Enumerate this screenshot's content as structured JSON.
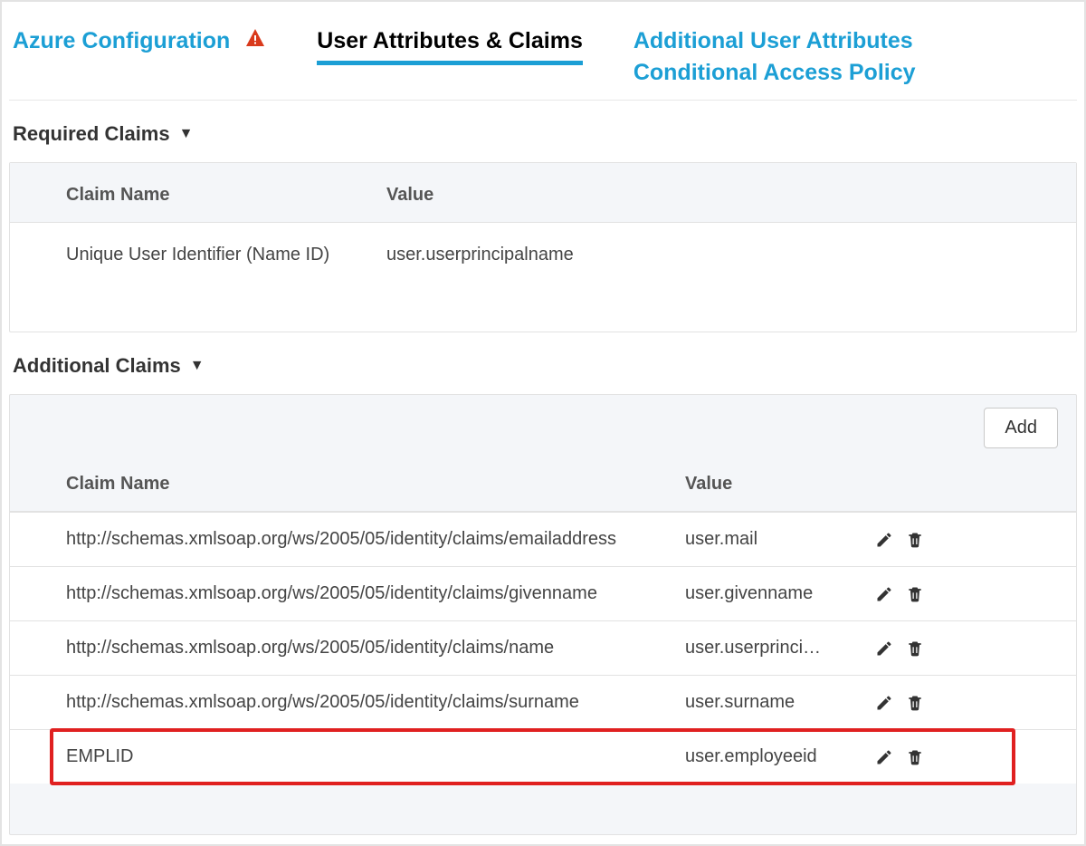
{
  "tabs": {
    "azure": "Azure Configuration",
    "attributes": "User Attributes & Claims",
    "additional": "Additional User Attributes",
    "conditional": "Conditional Access Policy"
  },
  "sections": {
    "required": "Required Claims",
    "additional": "Additional Claims"
  },
  "headers": {
    "claim": "Claim Name",
    "value": "Value"
  },
  "buttons": {
    "add": "Add"
  },
  "required_claims": [
    {
      "name": "Unique User Identifier (Name ID)",
      "value": "user.userprincipalname"
    }
  ],
  "additional_claims": [
    {
      "name": "http://schemas.xmlsoap.org/ws/2005/05/identity/claims/emailaddress",
      "value": "user.mail"
    },
    {
      "name": "http://schemas.xmlsoap.org/ws/2005/05/identity/claims/givenname",
      "value": "user.givenname"
    },
    {
      "name": "http://schemas.xmlsoap.org/ws/2005/05/identity/claims/name",
      "value": "user.userprinci…"
    },
    {
      "name": "http://schemas.xmlsoap.org/ws/2005/05/identity/claims/surname",
      "value": "user.surname"
    },
    {
      "name": "EMPLID",
      "value": "user.employeeid"
    }
  ]
}
